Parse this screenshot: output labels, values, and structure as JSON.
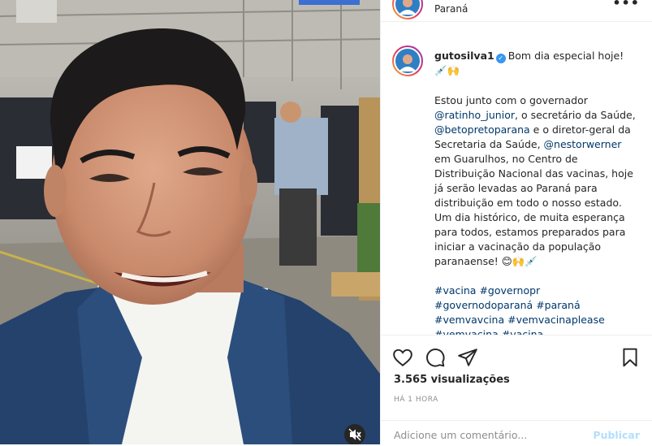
{
  "header": {
    "location": "Paraná",
    "more_label": "•••"
  },
  "post": {
    "username": "gutosilva1",
    "verified_mark": "✓",
    "intro": "Bom dia especial hoje! 💉🙌",
    "body_1": "Estou junto com o governador ",
    "mention_1": "@ratinho_junior",
    "body_2": ", o secretário da Saúde, ",
    "mention_2": "@betopretoparana",
    "body_3": " e o diretor-geral da Secretaria da Saúde, ",
    "mention_3": "@nestorwerner",
    "body_4": " em Guarulhos, no Centro de Distribuição Nacional das vacinas, hoje já serão levadas ao Paraná para distribuição em todo o nosso estado. Um dia histórico, de muita esperança para todos, estamos preparados para iniciar a vacinação da população paranaense! 😊🙌💉",
    "hashtags": [
      "#vacina",
      "#governopr",
      "#governodoparaná",
      "#paraná",
      "#vemvavcina",
      "#vemvacinaplease",
      "#vemvacina",
      "#vacina"
    ]
  },
  "stats": {
    "views": "3.565 visualizações",
    "time": "HÁ 1 HORA"
  },
  "comment": {
    "placeholder": "Adicione um comentário...",
    "publish_label": "Publicar"
  },
  "icons": {
    "like": "heart-icon",
    "comment": "comment-bubble-icon",
    "share": "paper-plane-icon",
    "save": "bookmark-icon",
    "mute": "muted-speaker-icon"
  },
  "colors": {
    "verified": "#3897f0",
    "link": "#00376b",
    "publish_disabled": "#b2dffc",
    "secondary_text": "#8e8e8e"
  }
}
